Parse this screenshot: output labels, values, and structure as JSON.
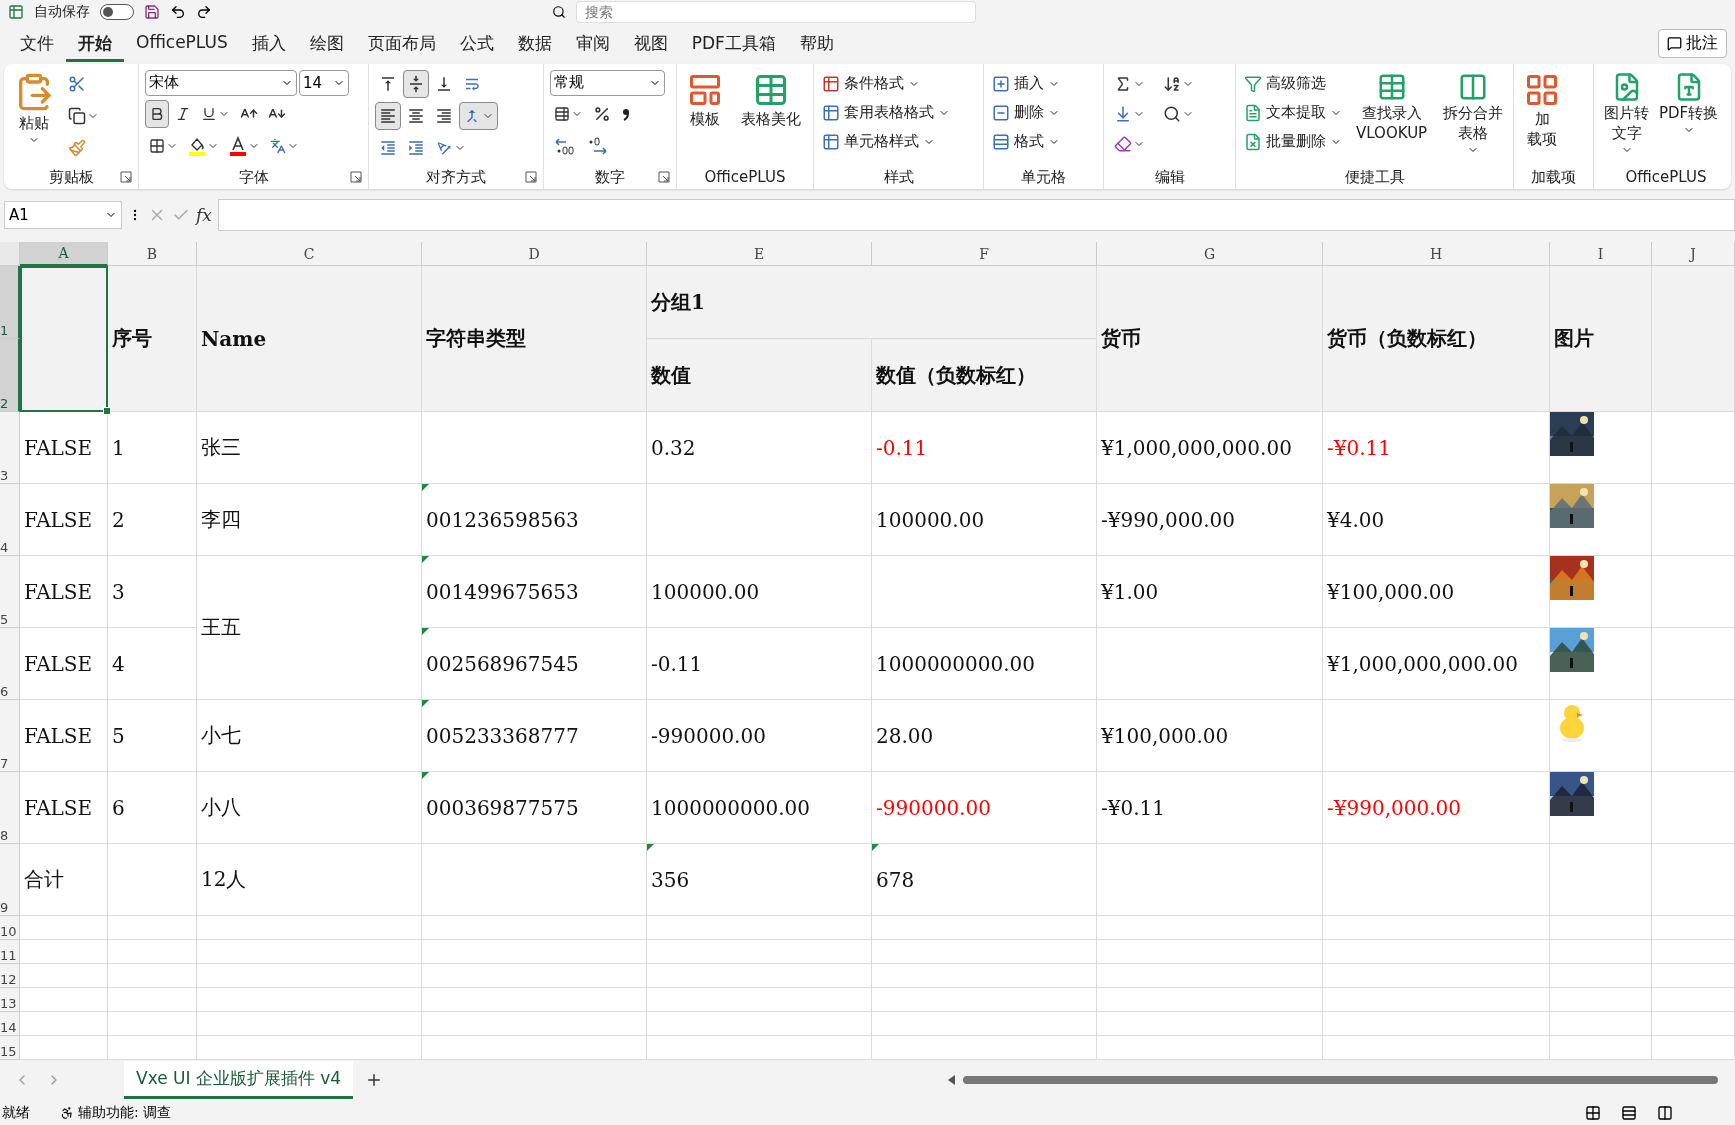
{
  "title_bar": {
    "autosave_label": "自动保存",
    "autosave_on": false,
    "search_placeholder": "搜索"
  },
  "menu_tabs": [
    {
      "label": "文件",
      "selected": false
    },
    {
      "label": "开始",
      "selected": true
    },
    {
      "label": "OfficePLUS",
      "selected": false
    },
    {
      "label": "插入",
      "selected": false
    },
    {
      "label": "绘图",
      "selected": false
    },
    {
      "label": "页面布局",
      "selected": false
    },
    {
      "label": "公式",
      "selected": false
    },
    {
      "label": "数据",
      "selected": false
    },
    {
      "label": "审阅",
      "selected": false
    },
    {
      "label": "视图",
      "selected": false
    },
    {
      "label": "PDF工具箱",
      "selected": false
    },
    {
      "label": "帮助",
      "selected": false
    }
  ],
  "comment_button": "批注",
  "ribbon": {
    "groups": [
      {
        "label": "剪贴板",
        "dialog_launcher": true,
        "items": [
          "粘贴"
        ]
      },
      {
        "label": "字体",
        "dialog_launcher": true,
        "font_name": "宋体",
        "font_size": "14",
        "bold": true
      },
      {
        "label": "对齐方式",
        "dialog_launcher": true,
        "middle_align": true,
        "left_align": true,
        "merge_center": true
      },
      {
        "label": "数字",
        "dialog_launcher": true,
        "number_format": "常规"
      },
      {
        "label": "OfficePLUS",
        "dialog_launcher": false,
        "items": [
          "模板",
          "表格美化"
        ]
      },
      {
        "label": "样式",
        "dialog_launcher": false,
        "items": [
          "条件格式",
          "套用表格格式",
          "单元格样式"
        ]
      },
      {
        "label": "单元格",
        "dialog_launcher": false,
        "items": [
          "插入",
          "删除",
          "格式"
        ]
      },
      {
        "label": "编辑",
        "dialog_launcher": false
      },
      {
        "label": "便捷工具",
        "dialog_launcher": false,
        "items": [
          "高级筛选",
          "文本提取",
          "批量删除",
          [
            "查找录入",
            "VLOOKUP"
          ],
          [
            "拆分合并",
            "表格"
          ]
        ]
      },
      {
        "label": "加载项",
        "dialog_launcher": false,
        "items": [
          [
            "加",
            "载项"
          ]
        ]
      },
      {
        "label": "OfficePLUS",
        "dialog_launcher": false,
        "items": [
          [
            "图片转",
            "文字"
          ],
          [
            "PDF转换"
          ]
        ]
      }
    ]
  },
  "formula_bar": {
    "name_box": "A1",
    "function_label": "fx"
  },
  "sheet": {
    "columns": [
      {
        "label": "A",
        "selected": true
      },
      {
        "label": "B",
        "selected": false
      },
      {
        "label": "C",
        "selected": false
      },
      {
        "label": "D",
        "selected": false
      },
      {
        "label": "E",
        "selected": false
      },
      {
        "label": "F",
        "selected": false
      },
      {
        "label": "G",
        "selected": false
      },
      {
        "label": "H",
        "selected": false
      },
      {
        "label": "I",
        "selected": false
      },
      {
        "label": "J",
        "selected": false
      }
    ],
    "row_numbers": [
      {
        "label": "1",
        "selected": true
      },
      {
        "label": "2",
        "selected": true
      },
      {
        "label": "3",
        "selected": false
      },
      {
        "label": "4",
        "selected": false
      },
      {
        "label": "5",
        "selected": false
      },
      {
        "label": "6",
        "selected": false
      },
      {
        "label": "7",
        "selected": false
      },
      {
        "label": "8",
        "selected": false
      },
      {
        "label": "9",
        "selected": false
      },
      {
        "label": "10",
        "selected": false
      },
      {
        "label": "11",
        "selected": false
      },
      {
        "label": "12",
        "selected": false
      },
      {
        "label": "13",
        "selected": false
      },
      {
        "label": "14",
        "selected": false
      },
      {
        "label": "15",
        "selected": false
      }
    ],
    "header": [
      {
        "text": "序号"
      },
      {
        "text": "Name"
      },
      {
        "text": "字符串类型"
      },
      {
        "text": "分组1",
        "children": [
          {
            "text": "数值"
          },
          {
            "text": "数值（负数标红）"
          }
        ]
      },
      {
        "text": "货币"
      },
      {
        "text": "货币（负数标红）"
      },
      {
        "text": "图片"
      }
    ],
    "rows": [
      {
        "cells": [
          {
            "text": "FALSE",
            "red": false,
            "flag": false
          },
          {
            "text": "1",
            "red": false,
            "flag": false
          },
          {
            "text": "张三",
            "red": false,
            "flag": false
          },
          null,
          {
            "text": "0.32",
            "red": false,
            "flag": false
          },
          {
            "text": "-0.11",
            "red": true,
            "flag": false
          },
          {
            "text": "¥1,000,000,000.00",
            "red": false,
            "flag": false
          },
          {
            "text": "-¥0.11",
            "red": true,
            "flag": false
          },
          {
            "kind": "picture"
          }
        ]
      },
      {
        "cells": [
          {
            "text": "FALSE",
            "red": false,
            "flag": false
          },
          {
            "text": "2",
            "red": false,
            "flag": false
          },
          {
            "text": "李四",
            "red": false,
            "flag": false
          },
          {
            "text": "001236598563",
            "red": false,
            "flag": true
          },
          null,
          {
            "text": "100000.00",
            "red": false,
            "flag": false
          },
          {
            "text": "-¥990,000.00",
            "red": false,
            "flag": false
          },
          {
            "text": "¥4.00",
            "red": false,
            "flag": false
          },
          {
            "kind": "picture"
          }
        ]
      },
      {
        "cells": [
          {
            "text": "FALSE",
            "red": false,
            "flag": false
          },
          {
            "text": "3",
            "red": false,
            "flag": false
          },
          {
            "text": "王五",
            "red": false,
            "flag": false,
            "merged_down": true
          },
          {
            "text": "001499675653",
            "red": false,
            "flag": true
          },
          {
            "text": "100000.00",
            "red": false,
            "flag": false
          },
          null,
          {
            "text": "¥1.00",
            "red": false,
            "flag": false
          },
          {
            "text": "¥100,000.00",
            "red": false,
            "flag": false
          },
          {
            "kind": "picture"
          }
        ]
      },
      {
        "cells": [
          {
            "text": "FALSE",
            "red": false,
            "flag": false
          },
          {
            "text": "4",
            "red": false,
            "flag": false
          },
          null,
          {
            "text": "002568967545",
            "red": false,
            "flag": true
          },
          {
            "text": "-0.11",
            "red": false,
            "flag": false
          },
          {
            "text": "1000000000.00",
            "red": false,
            "flag": false
          },
          null,
          {
            "text": "¥1,000,000,000.00",
            "red": false,
            "flag": false
          },
          {
            "kind": "picture"
          }
        ]
      },
      {
        "cells": [
          {
            "text": "FALSE",
            "red": false,
            "flag": false
          },
          {
            "text": "5",
            "red": false,
            "flag": false
          },
          {
            "text": "小七",
            "red": false,
            "flag": false
          },
          {
            "text": "005233368777",
            "red": false,
            "flag": true
          },
          {
            "text": "-990000.00",
            "red": false,
            "flag": false
          },
          {
            "text": "28.00",
            "red": false,
            "flag": false
          },
          {
            "text": "¥100,000.00",
            "red": false,
            "flag": false
          },
          null,
          {
            "kind": "picture"
          }
        ]
      },
      {
        "cells": [
          {
            "text": "FALSE",
            "red": false,
            "flag": false
          },
          {
            "text": "6",
            "red": false,
            "flag": false
          },
          {
            "text": "小八",
            "red": false,
            "flag": false
          },
          {
            "text": "000369877575",
            "red": false,
            "flag": true
          },
          {
            "text": "1000000000.00",
            "red": false,
            "flag": false
          },
          {
            "text": "-990000.00",
            "red": true,
            "flag": false
          },
          {
            "text": "-¥0.11",
            "red": false,
            "flag": false
          },
          {
            "text": "-¥990,000.00",
            "red": true,
            "flag": false
          },
          {
            "kind": "picture"
          }
        ]
      },
      {
        "cells": [
          {
            "text": "合计",
            "red": false,
            "flag": false
          },
          null,
          {
            "text": "12人",
            "red": false,
            "flag": false
          },
          null,
          {
            "text": "356",
            "red": false,
            "flag": true
          },
          {
            "text": "678",
            "red": false,
            "flag": true
          },
          null,
          null,
          null
        ]
      }
    ]
  },
  "sheet_tabs": [
    {
      "label": "Vxe UI 企业版扩展插件 v4",
      "selected": true
    }
  ],
  "status_bar": {
    "state": "就绪",
    "accessibility": "辅助功能: 调查"
  }
}
